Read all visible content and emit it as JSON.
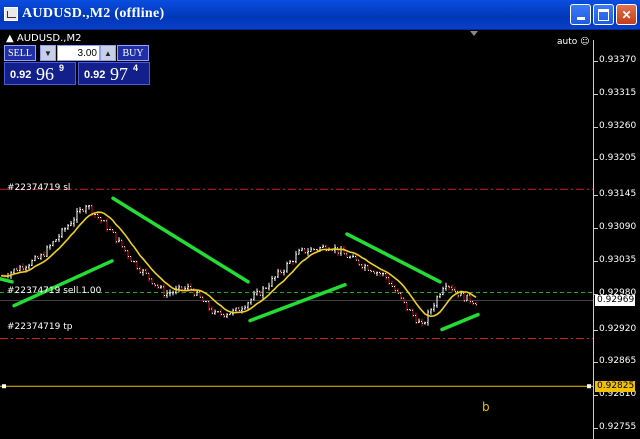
{
  "window": {
    "title": "AUDUSD.,M2 (offline)",
    "icon": "chart-icon"
  },
  "chart": {
    "symbol_label": "AUDUSD.,M2",
    "auto_label": "auto",
    "b_label": "b",
    "colors": {
      "background": "#000000",
      "candle": "#ffffff",
      "candle_bear": "#cc1111",
      "moving_average": "#f0d020",
      "trend_lines": "#22dd33",
      "order_sl_tp": "#cc2222",
      "order_entry": "#22aa22",
      "horizontal_line": "#f0c000"
    }
  },
  "trade_panel": {
    "sell_label": "SELL",
    "buy_label": "BUY",
    "lot_value": "3.00",
    "sell_price": {
      "small": "0.92",
      "big": "96",
      "sup": "9"
    },
    "buy_price": {
      "small": "0.92",
      "big": "97",
      "sup": "4"
    }
  },
  "orders": {
    "sl_label": "#22374719 sl",
    "entry_label": "#22374719 sell 1.00",
    "tp_label": "#22374719 tp",
    "sl_price": 0.93155,
    "entry_price": 0.92982,
    "tp_price": 0.92905
  },
  "price_axis": {
    "ticks": [
      "0.93370",
      "0.93315",
      "0.93260",
      "0.93205",
      "0.93145",
      "0.93090",
      "0.93035",
      "0.92980",
      "0.92920",
      "0.92865",
      "0.92810",
      "0.92755"
    ],
    "current_price": "0.92969",
    "hline_price": "0.92825"
  }
}
